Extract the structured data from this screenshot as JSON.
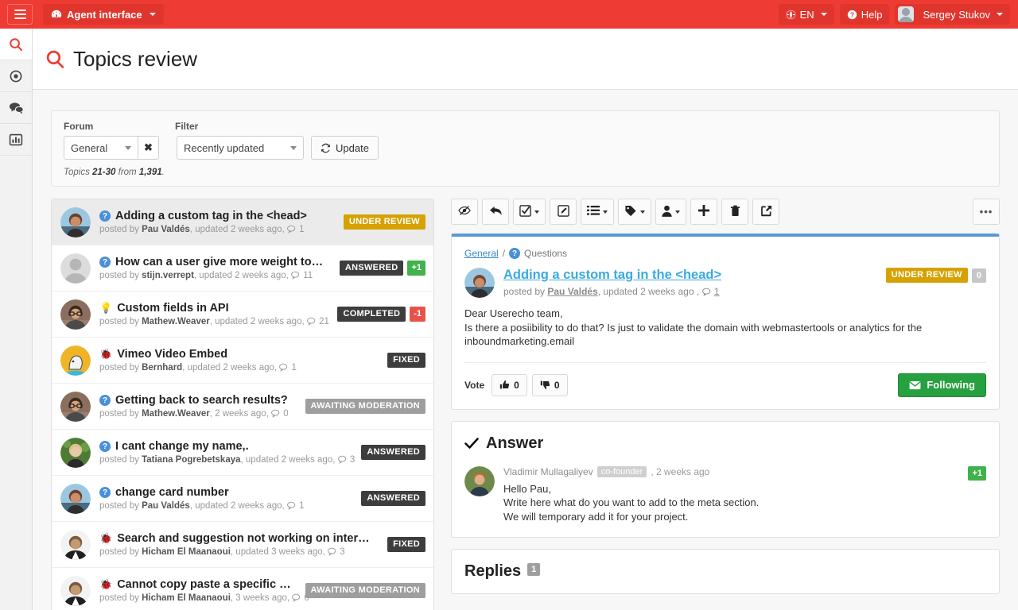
{
  "topbar": {
    "menu_icon": "hamburger-icon",
    "agent_button": "Agent interface",
    "lang_button": "EN",
    "help_button": "Help",
    "user_name": "Sergey Stukov"
  },
  "rail": {
    "items": [
      {
        "icon": "search-icon",
        "active": true
      },
      {
        "icon": "target-icon",
        "active": false
      },
      {
        "icon": "comments-icon",
        "active": false
      },
      {
        "icon": "bar-chart-icon",
        "active": false
      }
    ]
  },
  "page": {
    "title": "Topics review",
    "title_icon": "search-icon"
  },
  "filters": {
    "forum_label": "Forum",
    "filter_label": "Filter",
    "forum_value": "General",
    "forum_clear_icon": "close-icon",
    "filter_value": "Recently updated",
    "update_button": "Update",
    "update_icon": "refresh-icon",
    "count_prefix": "Topics ",
    "count_range": "21-30",
    "count_mid": " from ",
    "count_total": "1,391",
    "count_suffix": "."
  },
  "topics": [
    {
      "icon": "question-icon",
      "title": "Adding a custom tag in the <head>",
      "meta_prefix": "posted by ",
      "author": "Pau Valdés",
      "meta_suffix": ", updated 2 weeks ago, ",
      "comments": "1",
      "badge": "UNDER REVIEW",
      "badge_class": "under-review",
      "vote": "",
      "vote_class": "",
      "selected": true,
      "avatar": "man-beach"
    },
    {
      "icon": "question-icon",
      "title": "How can a user give more weight to votes?",
      "meta_prefix": "posted by ",
      "author": "stijn.verrept",
      "meta_suffix": ", updated 2 weeks ago, ",
      "comments": "11",
      "badge": "ANSWERED",
      "badge_class": "answered",
      "vote": "+1",
      "vote_class": "up",
      "selected": false,
      "avatar": "anon"
    },
    {
      "icon": "idea-icon",
      "title": "Custom fields in API",
      "meta_prefix": "posted by ",
      "author": "Mathew.Weaver",
      "meta_suffix": ", updated 2 weeks ago, ",
      "comments": "21",
      "badge": "COMPLETED",
      "badge_class": "completed",
      "vote": "-1",
      "vote_class": "down",
      "selected": false,
      "avatar": "man-glasses"
    },
    {
      "icon": "bug-icon",
      "title": "Vimeo Video Embed",
      "meta_prefix": "posted by ",
      "author": "Bernhard",
      "meta_suffix": ", updated 2 weeks ago, ",
      "comments": "1",
      "badge": "FIXED",
      "badge_class": "fixed",
      "vote": "",
      "vote_class": "",
      "selected": false,
      "avatar": "cartoon"
    },
    {
      "icon": "question-icon",
      "title": "Getting back to search results?",
      "meta_prefix": "posted by ",
      "author": "Mathew.Weaver",
      "meta_suffix": ", 2 weeks ago, ",
      "comments": "0",
      "badge": "AWAITING MODERATION",
      "badge_class": "awaiting",
      "vote": "",
      "vote_class": "",
      "selected": false,
      "avatar": "man-glasses"
    },
    {
      "icon": "question-icon",
      "title": "I cant change my name,.",
      "meta_prefix": "posted by ",
      "author": "Tatiana Pogrebetskaya",
      "meta_suffix": ", updated 2 weeks ago, ",
      "comments": "3",
      "badge": "ANSWERED",
      "badge_class": "answered",
      "vote": "",
      "vote_class": "",
      "selected": false,
      "avatar": "woman-green"
    },
    {
      "icon": "question-icon",
      "title": "change card number",
      "meta_prefix": "posted by ",
      "author": "Pau Valdés",
      "meta_suffix": ", updated 2 weeks ago, ",
      "comments": "1",
      "badge": "ANSWERED",
      "badge_class": "answered",
      "vote": "",
      "vote_class": "",
      "selected": false,
      "avatar": "man-beach"
    },
    {
      "icon": "bug-icon",
      "title": "Search and suggestion not working on internet ex…",
      "meta_prefix": "posted by ",
      "author": "Hicham El Maanaoui",
      "meta_suffix": ", updated 3 weeks ago, ",
      "comments": "3",
      "badge": "FIXED",
      "badge_class": "fixed",
      "vote": "",
      "vote_class": "",
      "selected": false,
      "avatar": "man-suit"
    },
    {
      "icon": "bug-icon",
      "title": "Cannot copy paste a specific conte…",
      "meta_prefix": "posted by ",
      "author": "Hicham El Maanaoui",
      "meta_suffix": ", 3 weeks ago, ",
      "comments": "0",
      "badge": "AWAITING MODERATION",
      "badge_class": "awaiting",
      "vote": "",
      "vote_class": "",
      "selected": false,
      "avatar": "man-suit"
    }
  ],
  "toolbar": {
    "buttons": [
      {
        "name": "hide-icon"
      },
      {
        "name": "reply-icon"
      },
      {
        "name": "check-square-icon",
        "caret": true
      },
      {
        "name": "edit-icon"
      },
      {
        "name": "list-icon",
        "caret": true
      },
      {
        "name": "tag-icon",
        "caret": true
      },
      {
        "name": "user-icon",
        "caret": true
      },
      {
        "name": "plus-icon"
      },
      {
        "name": "trash-icon"
      },
      {
        "name": "external-link-icon"
      }
    ],
    "more_label": "•••"
  },
  "topic_detail": {
    "breadcrumb_forum": "General",
    "breadcrumb_sep": "/",
    "breadcrumb_type_icon": "question-icon",
    "breadcrumb_type": "Questions",
    "title": "Adding a custom tag in the <head>",
    "meta_prefix": "posted by ",
    "author": "Pau Valdés",
    "meta_mid": ", updated 2 weeks ago , ",
    "comments": "1",
    "badge": "UNDER REVIEW",
    "vote_count": "0",
    "body_lines": [
      "Dear Userecho team,",
      "Is there a posiibility to do that? Is just to validate the domain with webmastertools or analytics for the",
      "inboundmarketing.email"
    ],
    "vote_label": "Vote",
    "vote_up_icon": "thumbs-up-icon",
    "vote_up_count": "0",
    "vote_down_icon": "thumbs-down-icon",
    "vote_down_count": "0",
    "follow_label": "Following",
    "follow_icon": "envelope-icon"
  },
  "answer": {
    "heading": "Answer",
    "heading_icon": "check-icon",
    "author": "Vladimir Mullagaliyev",
    "role_tag": "co-founder",
    "timestamp": ", 2 weeks ago",
    "vote": "+1",
    "lines": [
      "Hello Pau,",
      "Write here what do you want to add to the meta section.",
      "We will temporary add it for your project."
    ]
  },
  "replies": {
    "heading": "Replies",
    "count": "1"
  },
  "colors": {
    "brand_red": "#ee3b33",
    "accent_blue": "#5b9bd5",
    "link_blue": "#3aaae0",
    "badge_gold": "#d6a203",
    "badge_dark": "#3d3d3d",
    "badge_gray": "#9e9e9e",
    "vote_green": "#41b24b",
    "vote_red": "#e8524a",
    "follow_green": "#27a03f"
  }
}
